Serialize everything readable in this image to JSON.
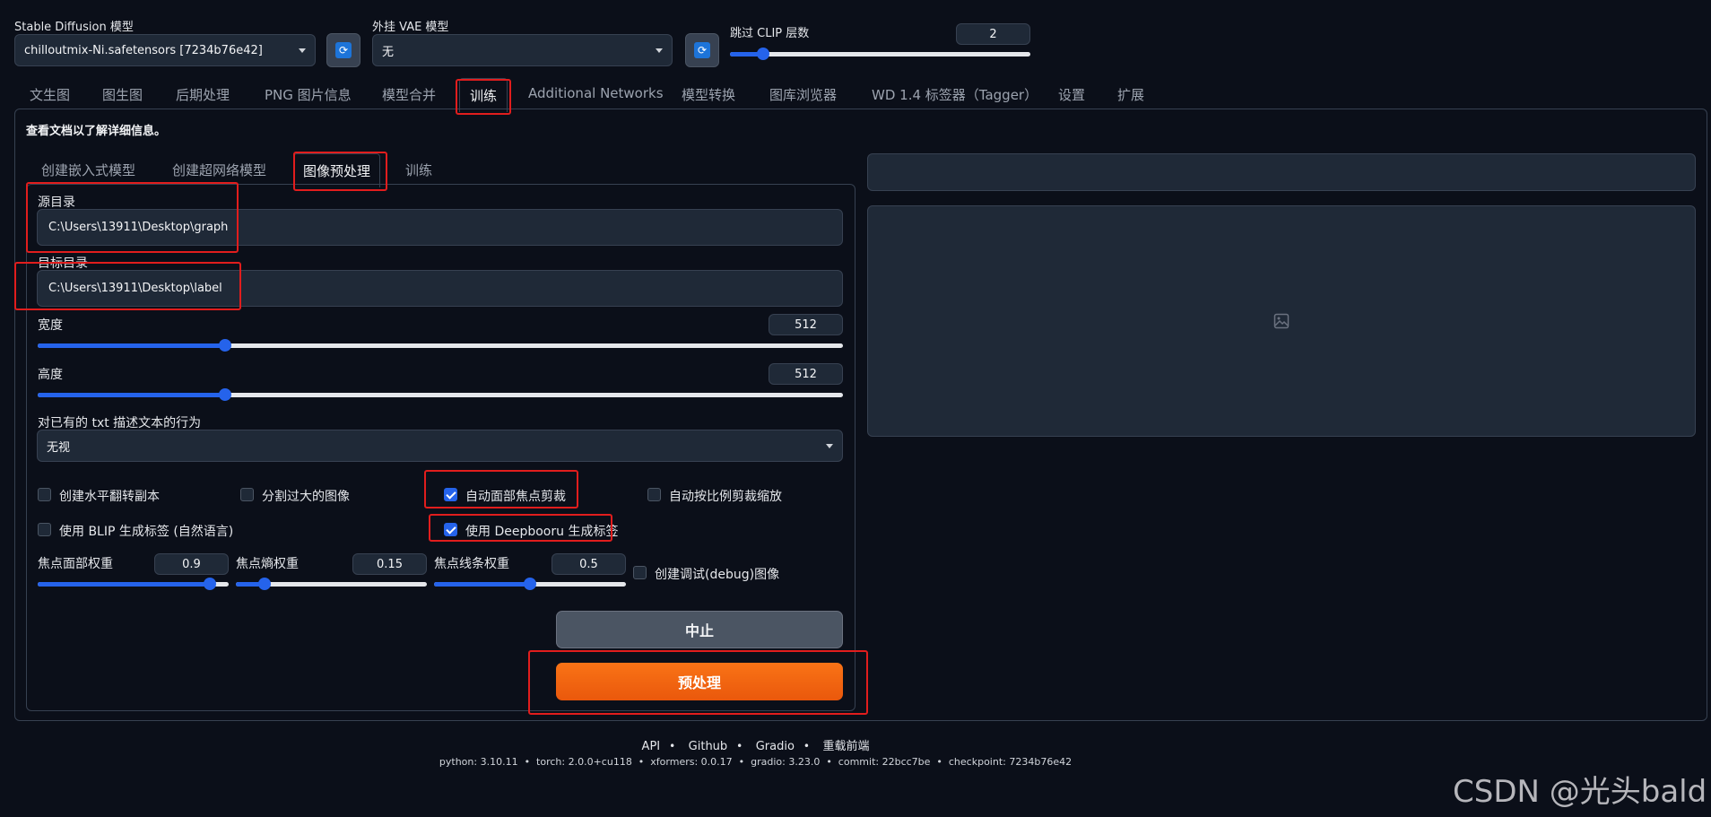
{
  "top": {
    "sd_model": {
      "label": "Stable Diffusion 模型",
      "value": "chilloutmix-Ni.safetensors [7234b76e42]"
    },
    "vae_model": {
      "label": "外挂 VAE 模型",
      "value": "无"
    },
    "clip_skip": {
      "label": "跳过 CLIP 层数",
      "value": "2",
      "slider_fraction": 0.11
    }
  },
  "tabs": [
    "文生图",
    "图生图",
    "后期处理",
    "PNG 图片信息",
    "模型合并",
    "训练",
    "Additional Networks",
    "模型转换",
    "图库浏览器",
    "WD 1.4 标签器（Tagger）",
    "设置",
    "扩展"
  ],
  "active_tab": "训练",
  "info_text": "查看文档以了解详细信息。",
  "subtabs": [
    "创建嵌入式模型",
    "创建超网络模型",
    "图像预处理",
    "训练"
  ],
  "active_subtab": "图像预处理",
  "form": {
    "source_dir": {
      "label": "源目录",
      "value": "C:\\Users\\13911\\Desktop\\graph"
    },
    "target_dir": {
      "label": "目标目录",
      "value": "C:\\Users\\13911\\Desktop\\label"
    },
    "width": {
      "label": "宽度",
      "value": "512",
      "slider_fraction": 0.233
    },
    "height": {
      "label": "高度",
      "value": "512",
      "slider_fraction": 0.233
    },
    "txt_action": {
      "label": "对已有的 txt 描述文本的行为",
      "value": "无视"
    },
    "checkboxes": {
      "flip": {
        "label": "创建水平翻转副本",
        "checked": false
      },
      "split": {
        "label": "分割过大的图像",
        "checked": false
      },
      "face_crop": {
        "label": "自动面部焦点剪裁",
        "checked": true
      },
      "auto_crop": {
        "label": "自动按比例剪裁缩放",
        "checked": false
      },
      "blip": {
        "label": "使用 BLIP 生成标签 (自然语言)",
        "checked": false
      },
      "deepbooru": {
        "label": "使用 Deepbooru 生成标签",
        "checked": true
      },
      "debug": {
        "label": "创建调试(debug)图像",
        "checked": false
      }
    },
    "focal_face": {
      "label": "焦点面部权重",
      "value": "0.9",
      "slider_fraction": 0.9
    },
    "focal_entropy": {
      "label": "焦点熵权重",
      "value": "0.15",
      "slider_fraction": 0.15
    },
    "focal_edges": {
      "label": "焦点线条权重",
      "value": "0.5",
      "slider_fraction": 0.5
    },
    "interrupt_button": "中止",
    "preprocess_button": "预处理"
  },
  "footer": {
    "links": [
      "API",
      "Github",
      "Gradio",
      "重载前端"
    ],
    "versions": "python: 3.10.11  •  torch: 2.0.0+cu118  •  xformers: 0.0.17  •  gradio: 3.23.0  •  commit: 22bcc7be  •  checkpoint: 7234b76e42"
  },
  "watermark": "CSDN @光头bald",
  "colors": {
    "background": "#0b0f19",
    "accent_blue": "#2563eb",
    "primary_orange": "#f97316",
    "highlight_red": "#e11d1d"
  }
}
